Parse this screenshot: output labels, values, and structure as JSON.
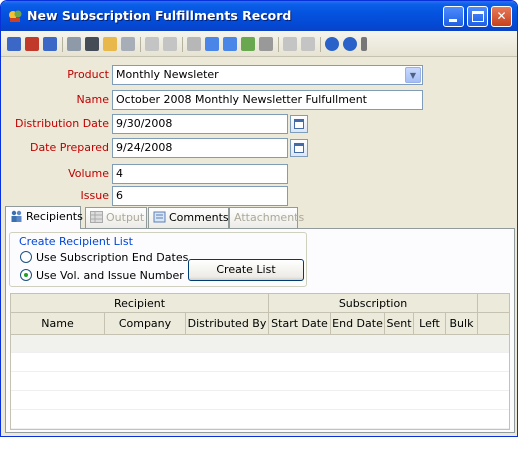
{
  "window": {
    "title": "New Subscription Fulfillments Record"
  },
  "toolbar": {
    "icons": [
      "save-icon",
      "save-new-icon",
      "save-close-icon",
      "print-icon",
      "find-icon",
      "open-icon",
      "list-icon",
      "forward-icon",
      "tools-icon",
      "copy-icon",
      "record-icon",
      "export-icon",
      "web-icon",
      "refresh-icon",
      "attach-icon",
      "clear-icon",
      "help-icon",
      "info-icon",
      "more-icon"
    ]
  },
  "form": {
    "product": {
      "label": "Product",
      "value": "Monthly Newsleter"
    },
    "name": {
      "label": "Name",
      "value": "October 2008 Monthly Newsletter Fulfullment"
    },
    "distribution_date": {
      "label": "Distribution Date",
      "value": "9/30/2008"
    },
    "date_prepared": {
      "label": "Date Prepared",
      "value": "9/24/2008"
    },
    "volume": {
      "label": "Volume",
      "value": "4"
    },
    "issue": {
      "label": "Issue",
      "value": "6"
    }
  },
  "tabs": [
    {
      "label": "Recipients",
      "state": "active"
    },
    {
      "label": "Output",
      "state": "disabled"
    },
    {
      "label": "Comments",
      "state": "normal"
    },
    {
      "label": "Attachments",
      "state": "disabled"
    }
  ],
  "recipients": {
    "group_title": "Create Recipient List",
    "option_end_dates": "Use Subscription End Dates",
    "option_vol_issue": "Use Vol. and Issue Number",
    "selected_option": "vol_issue",
    "create_button": "Create List"
  },
  "grid": {
    "groups": [
      "Recipient",
      "Subscription"
    ],
    "columns": [
      "Name",
      "Company",
      "Distributed By",
      "Start Date",
      "End Date",
      "Sent",
      "Left",
      "Bulk"
    ]
  },
  "colors": {
    "titlebar": "#0553e0",
    "label_required": "#c00000",
    "group_title": "#0046d5",
    "window_bg": "#ece9d8"
  }
}
